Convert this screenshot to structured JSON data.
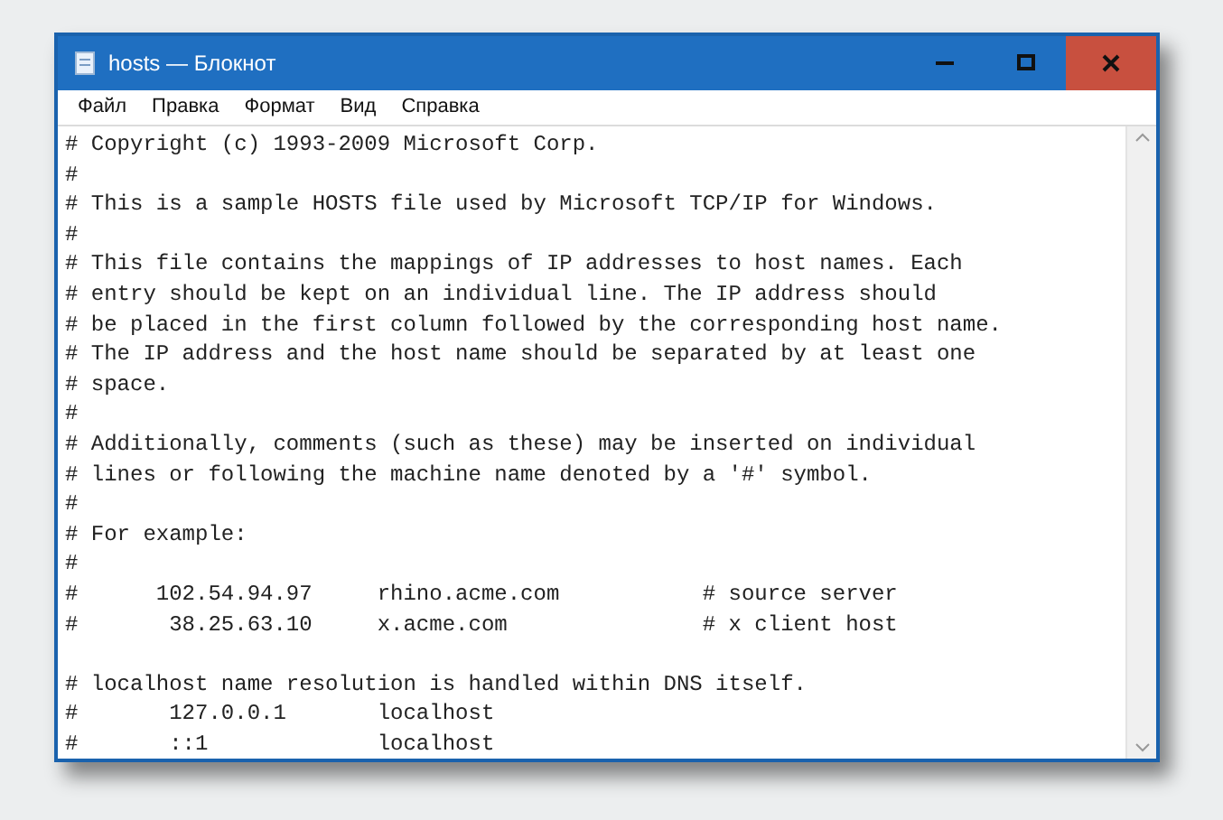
{
  "window": {
    "title": "hosts — Блокнот"
  },
  "menu": [
    "Файл",
    "Правка",
    "Формат",
    "Вид",
    "Справка"
  ],
  "editor": {
    "blocks": [
      [
        "# Copyright (c) 1993-2009 Microsoft Corp.",
        "#",
        "# This is a sample HOSTS file used by Microsoft TCP/IP for Windows.",
        "#",
        "# This file contains the mappings of IP addresses to host names. Each",
        "# entry should be kept on an individual line. The IP address should",
        "# be placed in the first column followed by the corresponding host name.",
        "# The IP address and the host name should be separated by at least one",
        "# space.",
        "#",
        "# Additionally, comments (such as these) may be inserted on individual",
        "# lines or following the machine name denoted by a '#' symbol.",
        "#",
        "# For example:",
        "#",
        "#      102.54.94.97     rhino.acme.com           # source server",
        "#       38.25.63.10     x.acme.com               # x client host"
      ],
      [
        "# localhost name resolution is handled within DNS itself.",
        "#       127.0.0.1       localhost",
        "#       ::1             localhost"
      ]
    ]
  }
}
